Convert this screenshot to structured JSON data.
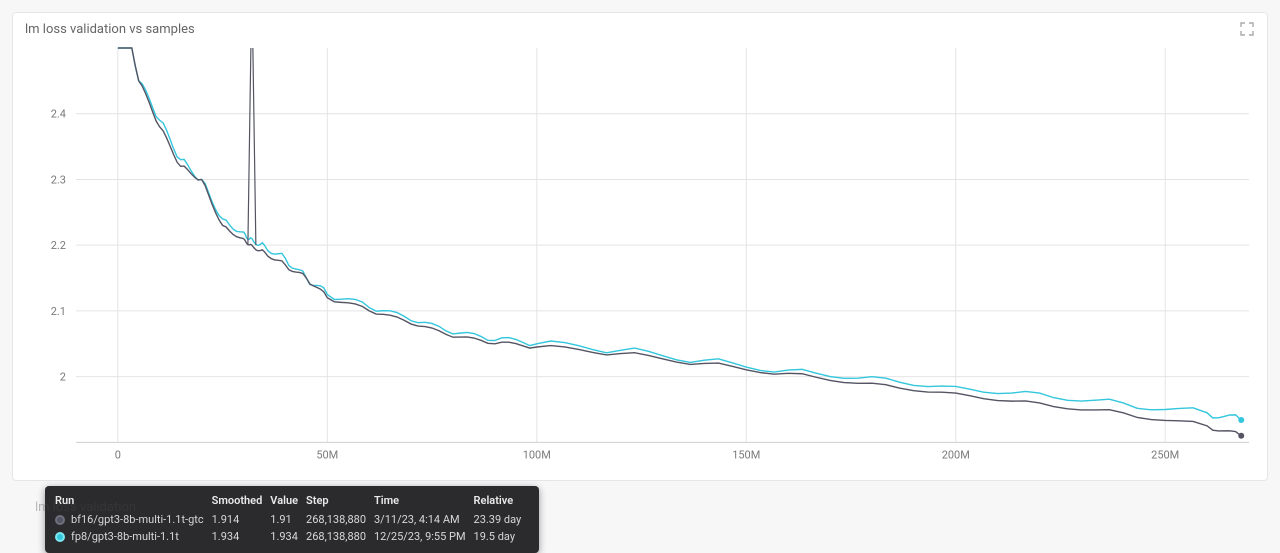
{
  "chart_data": {
    "type": "line",
    "title": "lm loss validation vs samples",
    "xlabel": "",
    "ylabel": "",
    "xlim": [
      -10000000,
      270000000
    ],
    "ylim": [
      1.9,
      2.5
    ],
    "x_tick_values": [
      0,
      50000000,
      100000000,
      150000000,
      200000000,
      250000000
    ],
    "x_tick_labels": [
      "0",
      "50M",
      "100M",
      "150M",
      "200M",
      "250M"
    ],
    "y_tick_values": [
      2.0,
      2.1,
      2.2,
      2.3,
      2.4
    ],
    "y_tick_labels": [
      "2",
      "2.1",
      "2.2",
      "2.3",
      "2.4"
    ],
    "x": [
      0,
      5000000,
      10000000,
      15000000,
      20000000,
      25000000,
      30000000,
      32000000,
      35000000,
      40000000,
      45000000,
      50000000,
      60000000,
      70000000,
      80000000,
      90000000,
      100000000,
      120000000,
      140000000,
      160000000,
      180000000,
      200000000,
      220000000,
      240000000,
      260000000,
      268138880
    ],
    "series": [
      {
        "name": "bf16/gpt3-8b-multi-1.1t-gtc",
        "color": "#545463",
        "values": [
          2.6,
          2.45,
          2.38,
          2.32,
          2.3,
          2.23,
          2.21,
          2.2,
          2.19,
          2.17,
          2.15,
          2.12,
          2.1,
          2.08,
          2.06,
          2.05,
          2.045,
          2.035,
          2.02,
          2.005,
          1.99,
          1.975,
          1.96,
          1.945,
          1.925,
          1.91
        ],
        "spike": {
          "x": 32000000,
          "y": 2.6
        }
      },
      {
        "name": "fp8/gpt3-8b-multi-1.1t",
        "color": "#33c6dd",
        "values": [
          2.6,
          2.45,
          2.39,
          2.33,
          2.3,
          2.24,
          2.22,
          2.21,
          2.2,
          2.18,
          2.15,
          2.125,
          2.105,
          2.085,
          2.065,
          2.055,
          2.05,
          2.04,
          2.025,
          2.01,
          2.0,
          1.985,
          1.975,
          1.96,
          1.945,
          1.934
        ]
      }
    ]
  },
  "tooltip": {
    "headers": [
      "Run",
      "Smoothed",
      "Value",
      "Step",
      "Time",
      "Relative"
    ],
    "rows": [
      {
        "swatch": "dark",
        "run": "bf16/gpt3-8b-multi-1.1t-gtc",
        "smoothed": "1.914",
        "value": "1.91",
        "step": "268,138,880",
        "time": "3/11/23, 4:14 AM",
        "relative": "23.39 day"
      },
      {
        "swatch": "light",
        "run": "fp8/gpt3-8b-multi-1.1t",
        "smoothed": "1.934",
        "value": "1.934",
        "step": "268,138,880",
        "time": "12/25/23, 9:55 PM",
        "relative": "19.5 day"
      }
    ]
  },
  "below_label": "lm loss validation",
  "icon_fullscreen_title": "fullscreen"
}
